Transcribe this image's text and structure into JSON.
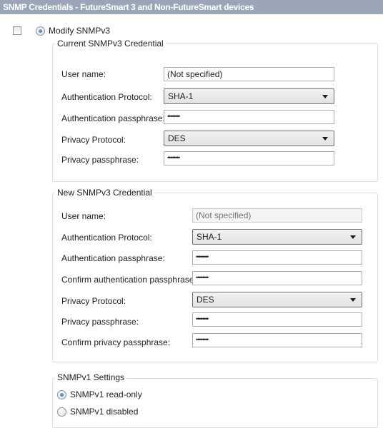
{
  "header": {
    "title": "SNMP Credentials - FutureSmart 3 and Non-FutureSmart devices"
  },
  "modify": {
    "label": "Modify SNMPv3"
  },
  "current": {
    "legend": "Current SNMPv3 Credential",
    "username_label": "User name:",
    "username_value": "(Not specified)",
    "auth_protocol_label": "Authentication Protocol:",
    "auth_protocol_value": "SHA-1",
    "auth_pass_label": "Authentication passphrase:",
    "auth_pass_value": "••••••••",
    "privacy_protocol_label": "Privacy Protocol:",
    "privacy_protocol_value": "DES",
    "privacy_pass_label": "Privacy passphrase:",
    "privacy_pass_value": "••••••••"
  },
  "new": {
    "legend": "New SNMPv3 Credential",
    "username_label": "User name:",
    "username_placeholder": "(Not specified)",
    "auth_protocol_label": "Authentication Protocol:",
    "auth_protocol_value": "SHA-1",
    "auth_pass_label": "Authentication passphrase:",
    "auth_pass_value": "••••••••",
    "confirm_auth_label": "Confirm authentication passphrase:",
    "confirm_auth_value": "••••••••",
    "privacy_protocol_label": "Privacy Protocol:",
    "privacy_protocol_value": "DES",
    "privacy_pass_label": "Privacy passphrase:",
    "privacy_pass_value": "••••••••",
    "confirm_privacy_label": "Confirm privacy passphrase:",
    "confirm_privacy_value": "••••••••"
  },
  "snmpv1": {
    "legend": "SNMPv1 Settings",
    "read_only_label": "SNMPv1 read-only",
    "disabled_label": "SNMPv1 disabled",
    "selected": "SNMPv1 read-only"
  }
}
